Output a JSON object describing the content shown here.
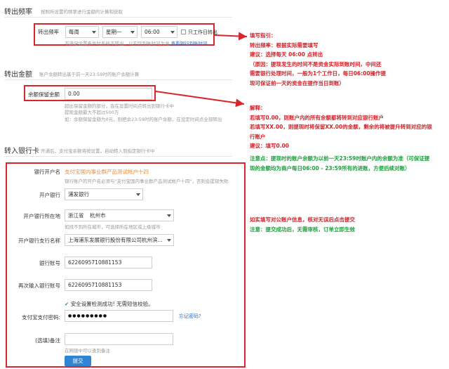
{
  "transfer_frequency": {
    "title": "转出频率",
    "hint": "按照所设置的频率进行金额的计算和获取",
    "field_label": "转出频率",
    "period": "每周",
    "weekday": "星期一",
    "time": "06:00",
    "workday_checkbox_label": "只工作日转出",
    "note": "不满足设置条件时系统不转出，以实际到账时间为准",
    "note_link": "查看银行到账时间"
  },
  "transfer_amount": {
    "title": "转出金额",
    "hint": "账户余额转出基于前一天23:59时的账户余额计算",
    "field_label": "余额保留金额",
    "value": "0.00",
    "help_lines": [
      "超出保留金额的部分，会在设置时间点转出到银行卡中",
      "提现金额最大不超过500万",
      "如：余额保留金额为0元，则把余23:59时的账户余额，在设定时间点全部转出"
    ]
  },
  "transfer_to_bank": {
    "title": "转入银行卡",
    "hint": "开通后，支付宝余额将按设置，自动转入到指定银行卡中",
    "account_holder_label": "银行开户名",
    "account_holder_value": "支付宝国内事业群产品测试帐户十四",
    "account_holder_note": "银行账户的开户名必须与\"支付宝国内事业群产品测试帐户十四\"，否则会提现失败",
    "bank_label": "开户银行",
    "bank_value": "浦发银行",
    "location_label": "开户银行所在地",
    "province": "浙江省",
    "city": "杭州市",
    "location_note": "如找不到所在城市，可选择所在地区或上级城市",
    "branch_label": "开户银行支行名称",
    "branch_value": "上海浦东发展银行股份有限公司杭州滨...",
    "account_label": "银行账号",
    "account_value": "6226095710881153",
    "confirm_label": "再次输入银行账号",
    "confirm_value": "6226095710881153",
    "security_msg": "安全设置检测成功! 无需短信校验。",
    "password_label": "支付宝支付密码:",
    "password_mask": "●●●●●●●●●",
    "forgot_link": "忘记密码?",
    "remark_label": "(选填)备注",
    "remark_note": "在网银中可以查到备注",
    "submit_label": "提交"
  },
  "annotations": {
    "freq_guide": {
      "title": "填写指引：",
      "lines": [
        "转出频率：根据实际需要填写",
        "建议：选择每天 06:00 点转出",
        "（原因：提现发生的时间不是资金实际到账时间，中间还",
        "需要银行处理时间，一般为1个工作日，每日06:00操作提",
        "现可保证前一天的资金在提作当日到账）"
      ]
    },
    "amount_guide": {
      "lines": [
        "解释：",
        "若填写0.00，则账户内的所有余额都将转到对应银行账户",
        "若填写XX.00，则提现时将保留XX.00的金额，剩余的将被提升转到对应的银",
        "行账户",
        "建议：填写0.00"
      ],
      "note": [
        "注意点：提现时的账户余额为以前一天23:59时账户内的余额为准（可保证提",
        "现的金额均为商户每日06:00 - 23:59所有的进账，方便后续对账）"
      ]
    },
    "bank_guide": {
      "line1": "如实填写对公账户信息，核对无误后点击提交",
      "line2": "注意：提交成功后，无需审核，订单立即生效"
    }
  },
  "colors": {
    "highlight_red": "#d8262b",
    "link_blue": "#2a6fc9",
    "orange": "#f28c28",
    "note_green": "#1e9e3e",
    "submit_blue": "#2f84d3"
  }
}
